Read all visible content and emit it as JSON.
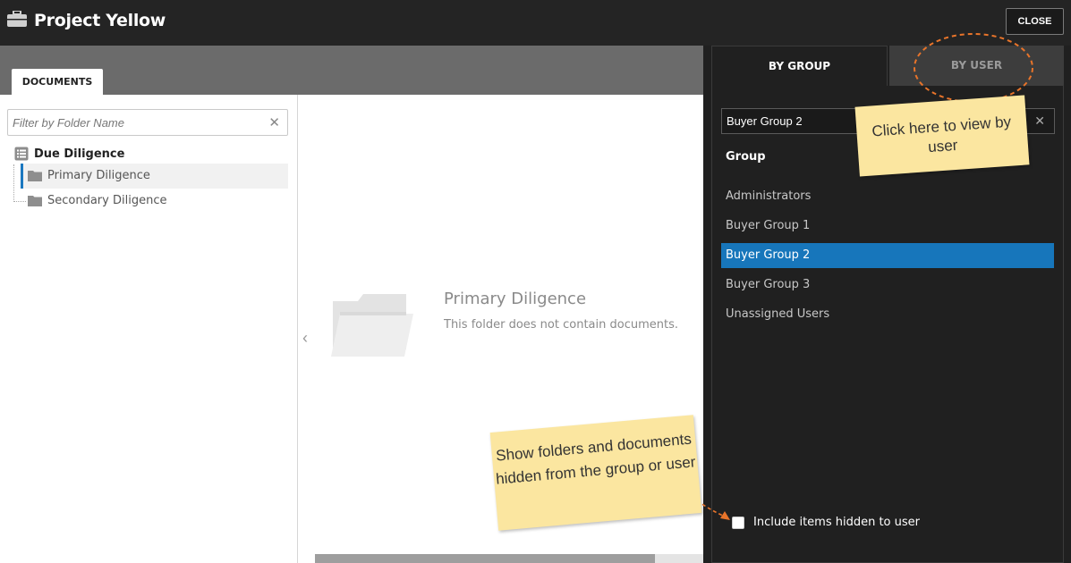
{
  "app": {
    "title": "Project Yellow",
    "close_label": "CLOSE",
    "icon": "briefcase-icon"
  },
  "documents": {
    "tab_label": "DOCUMENTS",
    "filter_placeholder": "Filter by Folder Name",
    "tree": {
      "root_label": "Due Diligence",
      "items": [
        {
          "label": "Primary Diligence",
          "selected": true
        },
        {
          "label": "Secondary Diligence",
          "selected": false
        }
      ]
    },
    "empty": {
      "title": "Primary Diligence",
      "description": "This folder does not contain documents."
    }
  },
  "permissions": {
    "tabs": [
      {
        "label": "BY GROUP",
        "active": true
      },
      {
        "label": "BY USER",
        "active": false
      }
    ],
    "group_search_value": "Buyer Group 2",
    "group_heading": "Group",
    "groups": [
      {
        "label": "Administrators",
        "active": false
      },
      {
        "label": "Buyer Group 1",
        "active": false
      },
      {
        "label": "Buyer Group 2",
        "active": true
      },
      {
        "label": "Buyer Group 3",
        "active": false
      },
      {
        "label": "Unassigned Users",
        "active": false
      }
    ],
    "include_hidden_label": "Include items hidden to user",
    "include_hidden_checked": false
  },
  "callouts": {
    "by_user_note": "Click here to view by user",
    "hidden_note": "Show folders and documents hidden from the group or user"
  },
  "colors": {
    "accent": "#1776bb",
    "note": "#fbe6a0",
    "annotation": "#e8742a"
  }
}
